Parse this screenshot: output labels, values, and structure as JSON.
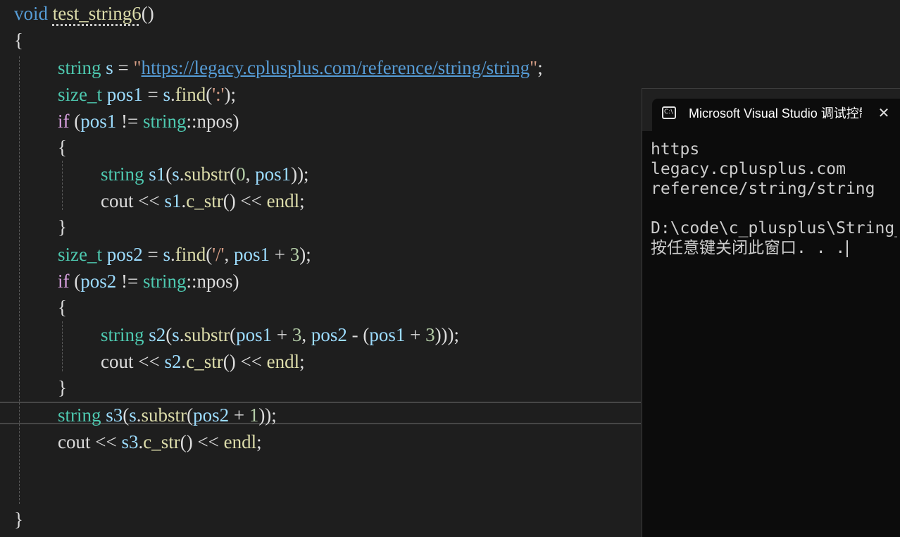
{
  "editor": {
    "lines": [
      [
        {
          "t": "void",
          "c": "kw"
        },
        {
          "t": " ",
          "c": "pl"
        },
        {
          "t": "test_string6",
          "c": "fn dots"
        },
        {
          "t": "()",
          "c": "pl"
        }
      ],
      [
        {
          "t": "{",
          "c": "pl"
        }
      ],
      [
        {
          "t": "string",
          "c": "ty"
        },
        {
          "t": " ",
          "c": "pl"
        },
        {
          "t": "s",
          "c": "var"
        },
        {
          "t": " = ",
          "c": "pl"
        },
        {
          "t": "\"",
          "c": "str"
        },
        {
          "t": "https://legacy.cplusplus.com/reference/string/string",
          "c": "url"
        },
        {
          "t": "\"",
          "c": "str"
        },
        {
          "t": ";",
          "c": "pl"
        }
      ],
      [
        {
          "t": "size_t",
          "c": "ty"
        },
        {
          "t": " ",
          "c": "pl"
        },
        {
          "t": "pos1",
          "c": "var"
        },
        {
          "t": " = ",
          "c": "pl"
        },
        {
          "t": "s",
          "c": "var"
        },
        {
          "t": ".",
          "c": "pl"
        },
        {
          "t": "find",
          "c": "fn"
        },
        {
          "t": "(",
          "c": "pl"
        },
        {
          "t": "':'",
          "c": "str"
        },
        {
          "t": ");",
          "c": "pl"
        }
      ],
      [
        {
          "t": "if",
          "c": "kw2"
        },
        {
          "t": " (",
          "c": "pl"
        },
        {
          "t": "pos1",
          "c": "var"
        },
        {
          "t": " != ",
          "c": "pl"
        },
        {
          "t": "string",
          "c": "ty"
        },
        {
          "t": "::npos)",
          "c": "pl"
        }
      ],
      [
        {
          "t": "{",
          "c": "pl"
        }
      ],
      [
        {
          "t": "string",
          "c": "ty"
        },
        {
          "t": " ",
          "c": "pl"
        },
        {
          "t": "s1",
          "c": "var"
        },
        {
          "t": "(",
          "c": "pl"
        },
        {
          "t": "s",
          "c": "var"
        },
        {
          "t": ".",
          "c": "pl"
        },
        {
          "t": "substr",
          "c": "fn"
        },
        {
          "t": "(",
          "c": "pl"
        },
        {
          "t": "0",
          "c": "num"
        },
        {
          "t": ", ",
          "c": "pl"
        },
        {
          "t": "pos1",
          "c": "var"
        },
        {
          "t": "));",
          "c": "pl"
        }
      ],
      [
        {
          "t": "cout",
          "c": "pl"
        },
        {
          "t": " << ",
          "c": "pl"
        },
        {
          "t": "s1",
          "c": "var"
        },
        {
          "t": ".",
          "c": "pl"
        },
        {
          "t": "c_str",
          "c": "fn"
        },
        {
          "t": "()",
          "c": "pl"
        },
        {
          "t": " << ",
          "c": "pl"
        },
        {
          "t": "endl",
          "c": "fn"
        },
        {
          "t": ";",
          "c": "pl"
        }
      ],
      [
        {
          "t": "}",
          "c": "pl"
        }
      ],
      [
        {
          "t": "size_t",
          "c": "ty"
        },
        {
          "t": " ",
          "c": "pl"
        },
        {
          "t": "pos2",
          "c": "var"
        },
        {
          "t": " = ",
          "c": "pl"
        },
        {
          "t": "s",
          "c": "var"
        },
        {
          "t": ".",
          "c": "pl"
        },
        {
          "t": "find",
          "c": "fn"
        },
        {
          "t": "(",
          "c": "pl"
        },
        {
          "t": "'/'",
          "c": "str"
        },
        {
          "t": ", ",
          "c": "pl"
        },
        {
          "t": "pos1",
          "c": "var"
        },
        {
          "t": " + ",
          "c": "pl"
        },
        {
          "t": "3",
          "c": "num"
        },
        {
          "t": ");",
          "c": "pl"
        }
      ],
      [
        {
          "t": "if",
          "c": "kw2"
        },
        {
          "t": " (",
          "c": "pl"
        },
        {
          "t": "pos2",
          "c": "var"
        },
        {
          "t": " != ",
          "c": "pl"
        },
        {
          "t": "string",
          "c": "ty"
        },
        {
          "t": "::npos)",
          "c": "pl"
        }
      ],
      [
        {
          "t": "{",
          "c": "pl"
        }
      ],
      [
        {
          "t": "string",
          "c": "ty"
        },
        {
          "t": " ",
          "c": "pl"
        },
        {
          "t": "s2",
          "c": "var"
        },
        {
          "t": "(",
          "c": "pl"
        },
        {
          "t": "s",
          "c": "var"
        },
        {
          "t": ".",
          "c": "pl"
        },
        {
          "t": "substr",
          "c": "fn"
        },
        {
          "t": "(",
          "c": "pl"
        },
        {
          "t": "pos1",
          "c": "var"
        },
        {
          "t": " + ",
          "c": "pl"
        },
        {
          "t": "3",
          "c": "num"
        },
        {
          "t": ", ",
          "c": "pl"
        },
        {
          "t": "pos2",
          "c": "var"
        },
        {
          "t": " - (",
          "c": "pl"
        },
        {
          "t": "pos1",
          "c": "var"
        },
        {
          "t": " + ",
          "c": "pl"
        },
        {
          "t": "3",
          "c": "num"
        },
        {
          "t": ")));",
          "c": "pl"
        }
      ],
      [
        {
          "t": "cout",
          "c": "pl"
        },
        {
          "t": " << ",
          "c": "pl"
        },
        {
          "t": "s2",
          "c": "var"
        },
        {
          "t": ".",
          "c": "pl"
        },
        {
          "t": "c_str",
          "c": "fn"
        },
        {
          "t": "()",
          "c": "pl"
        },
        {
          "t": " << ",
          "c": "pl"
        },
        {
          "t": "endl",
          "c": "fn"
        },
        {
          "t": ";",
          "c": "pl"
        }
      ],
      [
        {
          "t": "}",
          "c": "pl"
        }
      ],
      [
        {
          "t": "string",
          "c": "ty"
        },
        {
          "t": " ",
          "c": "pl"
        },
        {
          "t": "s3",
          "c": "var"
        },
        {
          "t": "(",
          "c": "pl"
        },
        {
          "t": "s",
          "c": "var"
        },
        {
          "t": ".",
          "c": "pl"
        },
        {
          "t": "substr",
          "c": "fn"
        },
        {
          "t": "(",
          "c": "pl"
        },
        {
          "t": "pos2",
          "c": "var"
        },
        {
          "t": " + ",
          "c": "pl"
        },
        {
          "t": "1",
          "c": "num"
        },
        {
          "t": "));",
          "c": "pl"
        }
      ],
      [
        {
          "t": "cout",
          "c": "pl"
        },
        {
          "t": " << ",
          "c": "pl"
        },
        {
          "t": "s3",
          "c": "var"
        },
        {
          "t": ".",
          "c": "pl"
        },
        {
          "t": "c_str",
          "c": "fn"
        },
        {
          "t": "()",
          "c": "pl"
        },
        {
          "t": " << ",
          "c": "pl"
        },
        {
          "t": "endl",
          "c": "fn"
        },
        {
          "t": ";",
          "c": "pl"
        }
      ],
      [],
      [],
      [
        {
          "t": "}",
          "c": "pl"
        }
      ]
    ],
    "colors": {
      "background": "#1e1e1e",
      "keyword": "#569cd6",
      "control": "#d8a0df",
      "type": "#4ec9b0",
      "variable": "#9cdcfe",
      "function": "#dcdcaa",
      "number": "#b5cea8",
      "string": "#d69d85"
    }
  },
  "console": {
    "icon": "console-window-icon",
    "title": "Microsoft Visual Studio 调试控制台",
    "close_icon": "close-icon",
    "close_glyph": "✕",
    "output": [
      "https",
      "legacy.cplusplus.com",
      "reference/string/string",
      "",
      "D:\\code\\c_plusplus\\String_",
      "按任意键关闭此窗口. . ."
    ]
  }
}
